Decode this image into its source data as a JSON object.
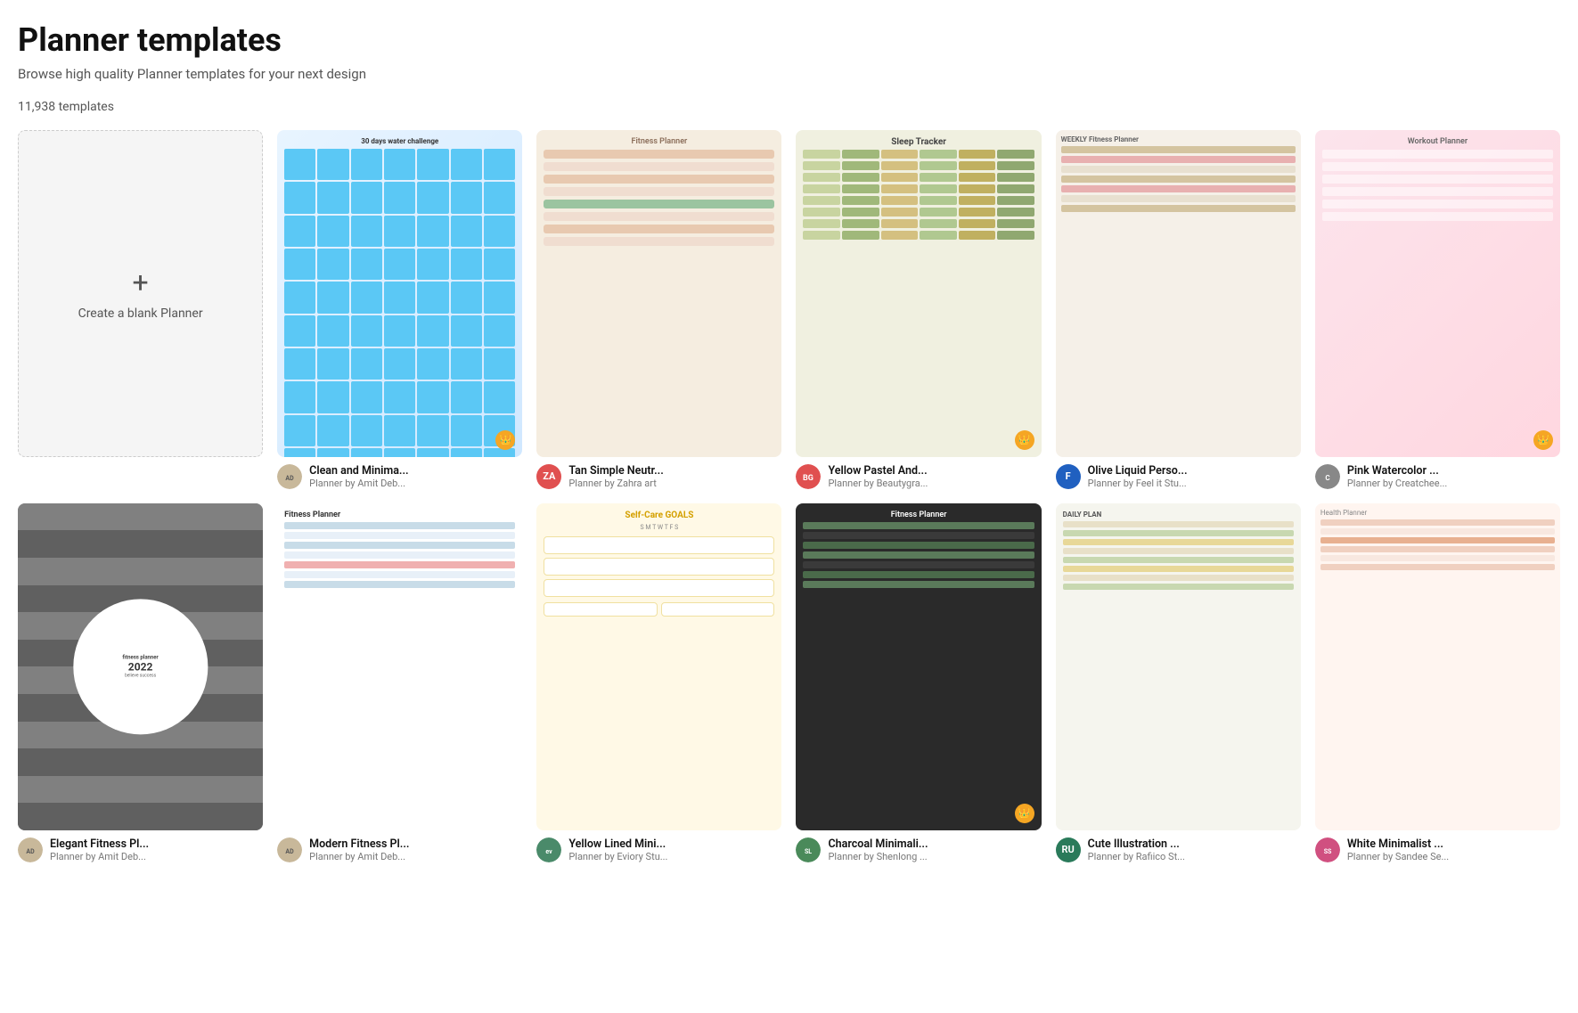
{
  "page": {
    "title": "Planner templates",
    "subtitle": "Browse high quality Planner templates for your next design",
    "template_count": "11,938 templates"
  },
  "blank_card": {
    "plus": "+",
    "label": "Create a blank Planner"
  },
  "templates": [
    {
      "id": "water-challenge",
      "name": "Clean and Minima...",
      "type": "Planner by Amit Deb...",
      "avatar_text": "",
      "avatar_color": "#c8b89a",
      "avatar_img": true,
      "has_crown": true,
      "visual": "water"
    },
    {
      "id": "fitness-beige",
      "name": "Tan Simple Neutr...",
      "type": "Planner by Zahra art",
      "avatar_text": "ZA",
      "avatar_color": "#e05050",
      "has_crown": false,
      "visual": "fitness-beige"
    },
    {
      "id": "sleep-tracker",
      "name": "Yellow Pastel And...",
      "type": "Planner by Beautygra...",
      "avatar_text": "",
      "avatar_color": "#e05050",
      "avatar_img": "beauty",
      "has_crown": true,
      "visual": "sleep"
    },
    {
      "id": "weekly-fitness",
      "name": "Olive Liquid Perso...",
      "type": "Planner by Feel it Stu...",
      "avatar_text": "F",
      "avatar_color": "#2060c0",
      "has_crown": false,
      "visual": "weekly"
    },
    {
      "id": "workout-planner",
      "name": "Pink Watercolor ...",
      "type": "Planner by Creatchee...",
      "avatar_text": "",
      "avatar_color": "#888",
      "avatar_img": "creatchee",
      "has_crown": true,
      "visual": "workout"
    },
    {
      "id": "fitness-striped",
      "name": "Elegant Fitness Pl...",
      "type": "Planner by Amit Deb...",
      "avatar_text": "",
      "avatar_color": "#c8b89a",
      "avatar_img": true,
      "has_crown": false,
      "visual": "fitness-striped"
    },
    {
      "id": "modern-fitness",
      "name": "Modern Fitness Pl...",
      "type": "Planner by Amit Deb...",
      "avatar_text": "",
      "avatar_color": "#c8b89a",
      "avatar_img": true,
      "has_crown": false,
      "visual": "fitness-white"
    },
    {
      "id": "selfcare-goals",
      "name": "Yellow Lined Mini...",
      "type": "Planner by Eviory Stu...",
      "avatar_text": "",
      "avatar_color": "#4a8a6a",
      "avatar_img": "eviory",
      "has_crown": false,
      "visual": "selfcare"
    },
    {
      "id": "charcoal-fitness",
      "name": "Charcoal Minimali...",
      "type": "Planner by Shenlong ...",
      "avatar_text": "",
      "avatar_color": "#4a8a5a",
      "avatar_img": "shenlong",
      "has_crown": true,
      "visual": "charcoal"
    },
    {
      "id": "daily-plan",
      "name": "Cute Illustration ...",
      "type": "Planner by Rafiico St...",
      "avatar_text": "RU",
      "avatar_color": "#2a7a5a",
      "has_crown": false,
      "visual": "daily"
    },
    {
      "id": "health-tracker",
      "name": "White Minimalist ...",
      "type": "Planner by Sandee Se...",
      "avatar_text": "",
      "avatar_color": "#d05080",
      "avatar_img": "sandee",
      "has_crown": false,
      "visual": "health"
    }
  ]
}
